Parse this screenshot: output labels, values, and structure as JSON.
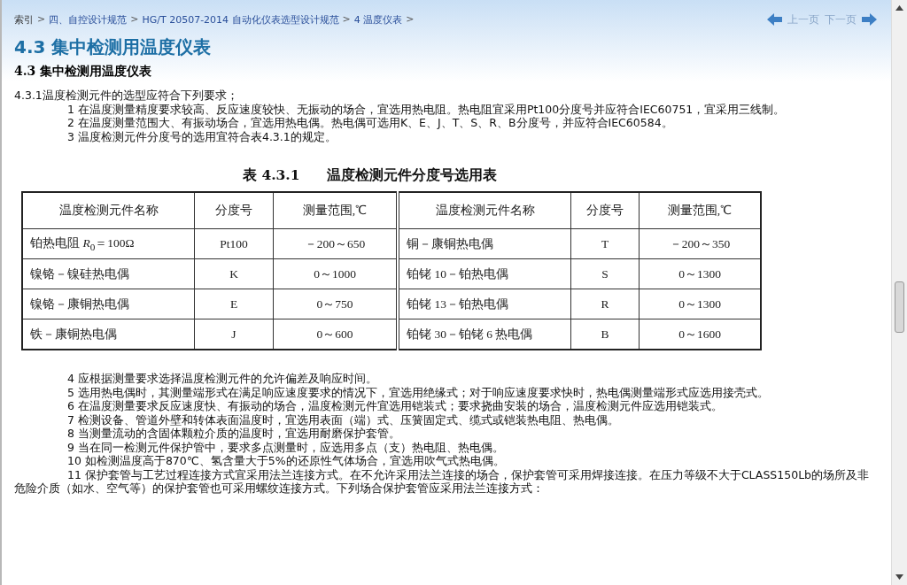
{
  "breadcrumb": {
    "separator": ">",
    "items": [
      {
        "label": "索引"
      },
      {
        "label": "四、自控设计规范"
      },
      {
        "label": "HG/T 20507-2014 自动化仪表选型设计规范"
      },
      {
        "label": "4 温度仪表"
      }
    ]
  },
  "nav": {
    "prev": "上一页",
    "next": "下一页"
  },
  "title": "4.3 集中检测用温度仪表",
  "section_heading": "4.3 集中检测用温度仪表",
  "paragraphs_before": [
    {
      "kind": "plain",
      "text": "4.3.1温度检测元件的选型应符合下列要求；"
    },
    {
      "kind": "numbered",
      "text": "1 在温度测量精度要求较高、反应速度较快、无振动的场合，宜选用热电阻。热电阻宜采用Pt100分度号并应符合IEC60751，宜采用三线制。"
    },
    {
      "kind": "numbered",
      "text": "2 在温度测量范围大、有振动场合，宜选用热电偶。热电偶可选用K、E、J、T、S、R、B分度号，并应符合IEC60584。"
    },
    {
      "kind": "numbered",
      "text": "3 温度检测元件分度号的选用宜符合表4.3.1的规定。"
    }
  ],
  "table": {
    "caption_number": "表 4.3.1",
    "caption_title": "温度检测元件分度号选用表",
    "columns": [
      "温度检测元件名称",
      "分度号",
      "测量范围,℃",
      "温度检测元件名称",
      "分度号",
      "测量范围,℃"
    ],
    "rows": [
      [
        "铂热电阻 *R*$_{0}$＝100Ω",
        "Pt100",
        "－200～650",
        "铜－康铜热电偶",
        "T",
        "－200～350"
      ],
      [
        "镍铬－镍硅热电偶",
        "K",
        "0～1000",
        "铂铑 10－铂热电偶",
        "S",
        "0～1300"
      ],
      [
        "镍铬－康铜热电偶",
        "E",
        "0～750",
        "铂铑 13－铂热电偶",
        "R",
        "0～1300"
      ],
      [
        "铁－康铜热电偶",
        "J",
        "0～600",
        "铂铑 30－铂铑 6 热电偶",
        "B",
        "0～1600"
      ]
    ]
  },
  "paragraphs_after": [
    {
      "kind": "numbered",
      "text": "4 应根据测量要求选择温度检测元件的允许偏差及响应时间。"
    },
    {
      "kind": "numbered",
      "text": "5 选用热电偶时，其测量端形式在满足响应速度要求的情况下，宜选用绝缘式；对于响应速度要求快时，热电偶测量端形式应选用接壳式。"
    },
    {
      "kind": "numbered",
      "text": "6 在温度测量要求反应速度快、有振动的场合，温度检测元件宜选用铠装式；要求挠曲安装的场合，温度检测元件应选用铠装式。"
    },
    {
      "kind": "numbered",
      "text": "7 检测设备、管道外壁和转体表面温度时，宜选用表面（端）式、压簧固定式、缆式或铠装热电阻、热电偶。"
    },
    {
      "kind": "numbered",
      "text": "8 当测量流动的含固体颗粒介质的温度时，宜选用耐磨保护套管。"
    },
    {
      "kind": "numbered",
      "text": "9 当在同一检测元件保护管中，要求多点测量时，应选用多点（支）热电阻、热电偶。"
    },
    {
      "kind": "numbered",
      "text": "10 如检测温度高于870℃、氢含量大于5%的还原性气体场合，宜选用吹气式热电偶。"
    },
    {
      "kind": "numbered",
      "text": "11 保护套管与工艺过程连接方式宜采用法兰连接方式。在不允许采用法兰连接的场合，保护套管可采用焊接连接。在压力等级不大于CLASS150Lb的场所及非危险介质（如水、空气等）的保护套管也可采用螺纹连接方式。下列场合保护套管应采用法兰连接方式："
    }
  ]
}
